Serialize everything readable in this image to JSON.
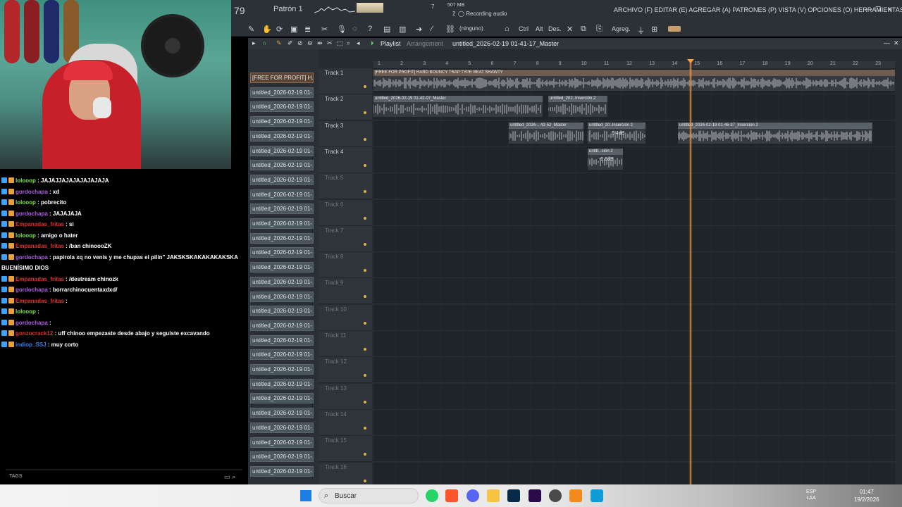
{
  "fl": {
    "bpm": "79",
    "pattern": "Patrón 1",
    "counter": "7",
    "memory": "507 MB",
    "cpu": "2",
    "recording": "Recording audio",
    "menu": "ARCHIVO (F) EDITAR (E) AGREGAR (A) PATRONES (P) VISTA (V) OPCIONES (O) HERRAMIENTAS (T) AYUDA",
    "snap": "(ninguno)",
    "ctrl": "Ctrl",
    "alt": "Alt",
    "des": "Des.",
    "agreg": "Agreg."
  },
  "playlist": {
    "title": "Playlist",
    "subtitle": "Arrangement",
    "file": "untitled_2026-02-19 01-41-17_Master"
  },
  "browser": {
    "items": [
      "[FREE FOR PROFIT] H...",
      "untitled_2026-02-19 01-...",
      "untitled_2026-02-19 01-...",
      "untitled_2026-02-19 01-...",
      "untitled_2026-02-19 01-...",
      "untitled_2026-02-19 01-...",
      "untitled_2026-02-19 01-...",
      "untitled_2026-02-19 01-...",
      "untitled_2026-02-19 01-...",
      "untitled_2026-02-19 01-...",
      "untitled_2026-02-19 01-...",
      "untitled_2026-02-19 01-...",
      "untitled_2026-02-19 01-...",
      "untitled_2026-02-19 01-...",
      "untitled_2026-02-19 01-...",
      "untitled_2026-02-19 01-...",
      "untitled_2026-02-19 01-...",
      "untitled_2026-02-19 01-...",
      "untitled_2026-02-19 01-...",
      "untitled_2026-02-19 01-...",
      "untitled_2026-02-19 01-...",
      "untitled_2026-02-19 01-...",
      "untitled_2026-02-19 01-...",
      "untitled_2026-02-19 01-...",
      "untitled_2026-02-19 01-...",
      "untitled_2026-02-19 01-...",
      "untitled_2026-02-19 01-...",
      "untitled_2026-02-19 01-..."
    ]
  },
  "ruler": [
    "1",
    "2",
    "3",
    "4",
    "5",
    "6",
    "7",
    "8",
    "9",
    "10",
    "11",
    "12",
    "13",
    "14",
    "15",
    "16",
    "17",
    "18",
    "19",
    "20",
    "21",
    "22",
    "23"
  ],
  "tracks": [
    "Track 1",
    "Track 2",
    "Track 3",
    "Track 4",
    "Track 5",
    "Track 6",
    "Track 7",
    "Track 8",
    "Track 9",
    "Track 10",
    "Track 11",
    "Track 12",
    "Track 13",
    "Track 14",
    "Track 15",
    "Track 16"
  ],
  "clips": {
    "t1": "[FREE FOR PROFIT] HARD BOUNCY TRAP TYPE BEAT SHAWTY",
    "t2a": "untitled_2026-02-19 01-42-07_Master",
    "t2b": "untitled_202..Inserción 2",
    "t3a": "untitled_2026-...42-52_Master",
    "t3b": "untitled_20..Inserción 2",
    "t3b_gain": "6.4dB",
    "t3c": "untitled_2026-02-19 01-46-37_Inserción 2",
    "t4a": "untitl...ción 2",
    "t4a_gain": "-5.8dB"
  },
  "chat": [
    {
      "user": "lolooop",
      "msg": "JAJAJJAJAJAJAJAJAJA",
      "color": "#7be34a"
    },
    {
      "user": "gordochapa",
      "msg": "xd",
      "color": "#b15ce6"
    },
    {
      "user": "lolooop",
      "msg": "pobrecito",
      "color": "#7be34a"
    },
    {
      "user": "gordochapa",
      "msg": "JAJAJAJA",
      "color": "#b15ce6"
    },
    {
      "user": "Empanadas_fritas",
      "msg": "si",
      "color": "#e0312e"
    },
    {
      "user": "lolooop",
      "msg": "amigo o hater",
      "color": "#7be34a"
    },
    {
      "user": "Empanadas_fritas",
      "msg": "/ban chinoooZK",
      "color": "#e0312e"
    },
    {
      "user": "gordochapa",
      "msg": "papirola xq no venis y me chupas el pilin\" JAKSKSKAKAKAKAKSKA",
      "color": "#b15ce6"
    },
    {
      "user": "",
      "msg": "BUENÍSIMO DIOS",
      "color": "#fff"
    },
    {
      "user": "Empanadas_fritas",
      "msg": "/destream chinozk",
      "color": "#e0312e"
    },
    {
      "user": "gordochapa",
      "msg": "borrarchinocuentaxdxd/",
      "color": "#b15ce6"
    },
    {
      "user": "Empanadas_fritas",
      "msg": "",
      "color": "#e0312e"
    },
    {
      "user": "lolooop",
      "msg": "",
      "color": "#7be34a"
    },
    {
      "user": "gordochapa",
      "msg": "",
      "color": "#b15ce6"
    },
    {
      "user": "gonzocrack12",
      "msg": "uff chinoo empezaste desde abajo y seguiste excavando",
      "color": "#e0312e"
    },
    {
      "user": "indiop_SSJ",
      "msg": "muy corto",
      "color": "#3f7fe8"
    }
  ],
  "chat_footer": {
    "tags": "TAGS"
  },
  "taskbar": {
    "search": "Buscar",
    "lang_top": "ESP",
    "lang_bottom": "LAA",
    "time": "01:47",
    "date": "19/2/2026"
  }
}
